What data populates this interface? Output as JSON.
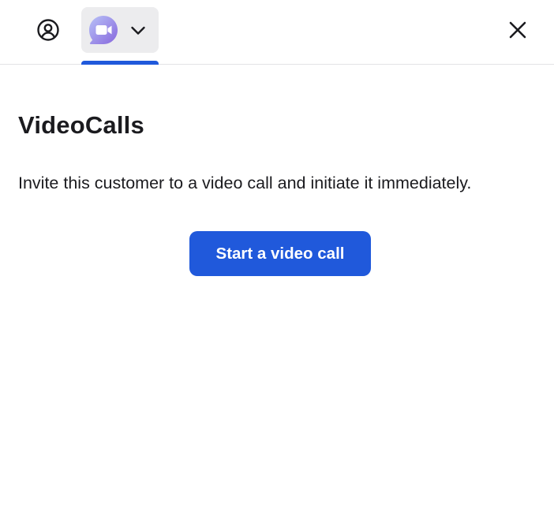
{
  "header": {
    "profile_icon": "user-circle-icon",
    "app_icon": "video-chat-bubble-icon",
    "dropdown_icon": "chevron-down-icon",
    "close_icon": "close-icon",
    "accent_color": "#2059db",
    "app_icon_gradient": [
      "#a9b4f5",
      "#8a6fe0"
    ]
  },
  "main": {
    "title": "VideoCalls",
    "description": "Invite this customer to a video call and initiate it immediately.",
    "start_button_label": "Start a video call"
  }
}
